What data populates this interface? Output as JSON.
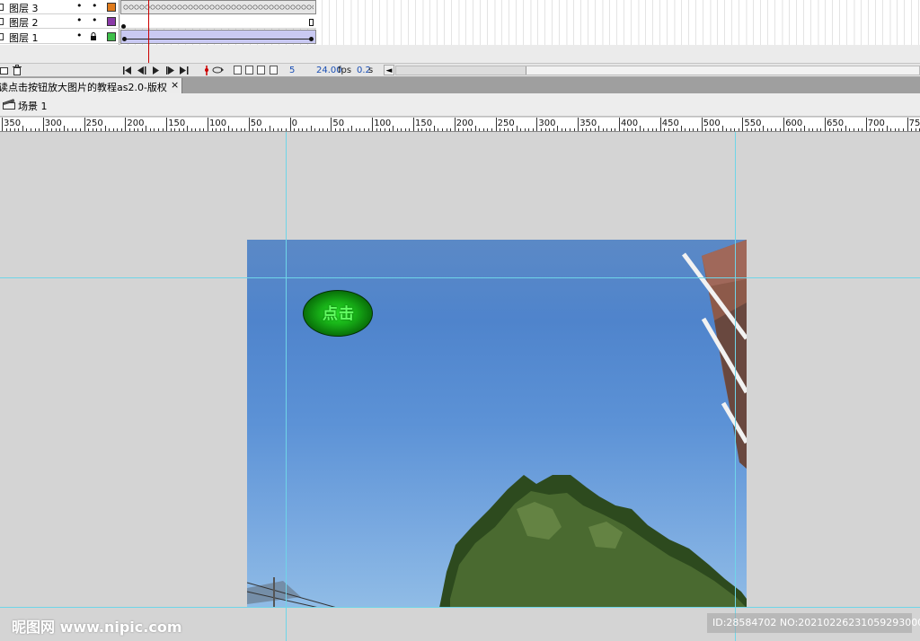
{
  "timeline": {
    "layers": [
      {
        "name": "图层 3",
        "visible_dot": "•",
        "lock_dot": "•",
        "locked": false,
        "color": "#e07b1c"
      },
      {
        "name": "图层 2",
        "visible_dot": "•",
        "lock_dot": "•",
        "locked": false,
        "color": "#8a3aa8"
      },
      {
        "name": "图层 1",
        "visible_dot": "•",
        "lock_dot": "",
        "locked": true,
        "color": "#3ec04a"
      }
    ],
    "controls": {
      "current_frame": "5",
      "fps_value": "24.00",
      "fps_unit": "fps",
      "time_value": "0.2",
      "time_unit": "s",
      "scroll_left": "◄"
    }
  },
  "document": {
    "tab_title": "读点击按钮放大图片的教程as2.0-版权",
    "close": "×"
  },
  "edit_bar": {
    "scene_label": "场景 1"
  },
  "ruler": {
    "labels": [
      "350",
      "300",
      "250",
      "200",
      "150",
      "100",
      "50",
      "0",
      "50",
      "100",
      "150",
      "200",
      "250",
      "300",
      "350",
      "400",
      "450",
      "500",
      "550",
      "600",
      "650",
      "700",
      "750"
    ]
  },
  "stage": {
    "button_label": "点击"
  },
  "watermark": {
    "logo": "昵图网 www.nipic.com",
    "id": "ID:28584702 NO:20210226231059293000"
  },
  "colors": {
    "guide": "#6fd5e8",
    "playhead": "#cc0000",
    "sky_top": "#5b89c6",
    "sky_bottom": "#90bce6",
    "button_green": "#18b218"
  }
}
